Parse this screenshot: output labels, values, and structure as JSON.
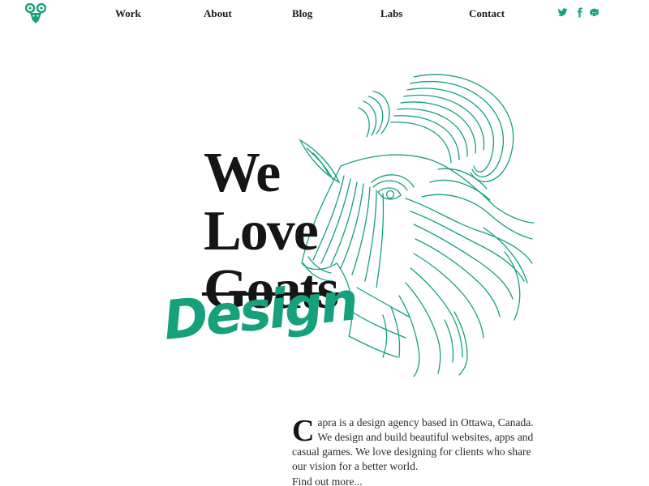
{
  "brand": {
    "accent_color": "#16a07b",
    "logo_icon": "goat-head-icon"
  },
  "nav": {
    "items": [
      {
        "label": "Work"
      },
      {
        "label": "About"
      },
      {
        "label": "Blog"
      },
      {
        "label": "Labs"
      },
      {
        "label": "Contact"
      }
    ]
  },
  "social": {
    "icons": [
      "twitter-icon",
      "facebook-icon",
      "github-icon"
    ]
  },
  "hero": {
    "line1": "We",
    "line2": "Love",
    "struck_word": "Goats",
    "replacement_word": "Design",
    "illustration": "goat-illustration"
  },
  "intro": {
    "dropcap": "C",
    "text": "apra is a design agency based in Ottawa, Canada. We design and build beautiful websites, apps and casual games. We love designing for clients who share our vision for a better world.",
    "link_label": "Find out more..."
  }
}
